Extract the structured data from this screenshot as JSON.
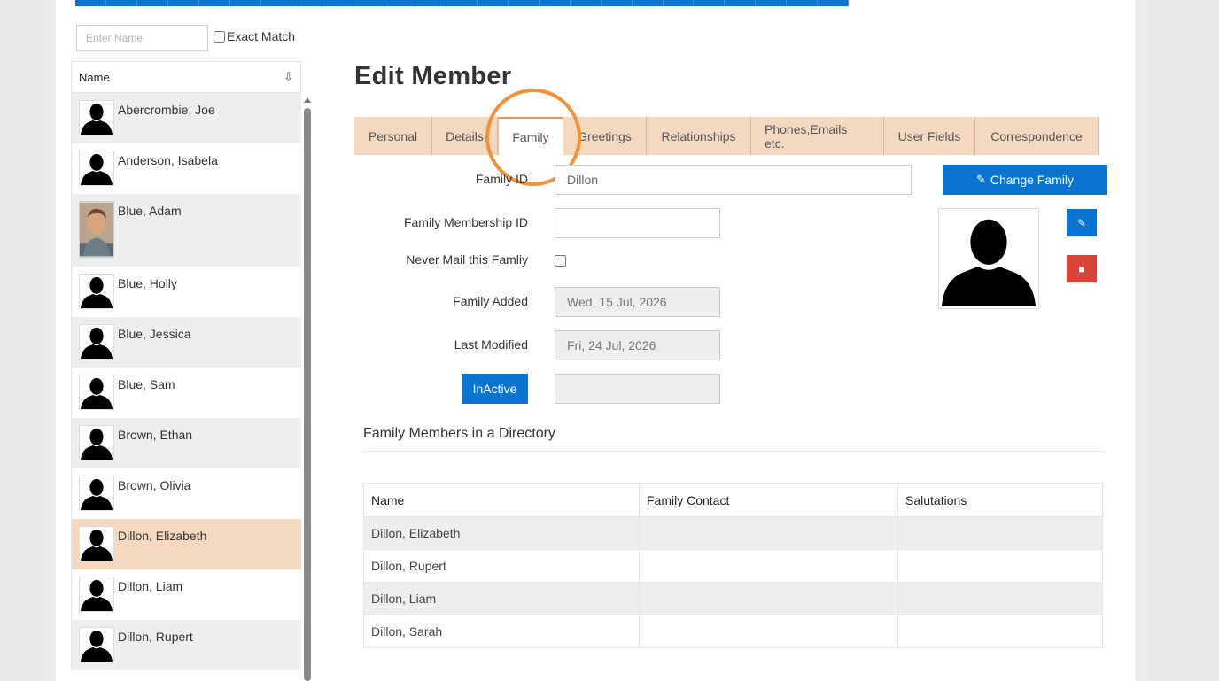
{
  "search": {
    "placeholder": "Enter Name",
    "exact_match_label": "Exact Match"
  },
  "list": {
    "header": "Name",
    "members": [
      {
        "name": "Abercrombie, Joe",
        "style": "alt"
      },
      {
        "name": "Anderson, Isabela",
        "style": ""
      },
      {
        "name": "Blue, Adam",
        "style": "alt"
      },
      {
        "name": "Blue, Holly",
        "style": ""
      },
      {
        "name": "Blue, Jessica",
        "style": "alt"
      },
      {
        "name": "Blue, Sam",
        "style": ""
      },
      {
        "name": "Brown, Ethan",
        "style": "alt"
      },
      {
        "name": "Brown, Olivia",
        "style": ""
      },
      {
        "name": "Dillon, Elizabeth",
        "style": "selected"
      },
      {
        "name": "Dillon, Liam",
        "style": ""
      },
      {
        "name": "Dillon, Rupert",
        "style": "alt"
      }
    ]
  },
  "main": {
    "title": "Edit Member",
    "tabs": [
      "Personal",
      "Details",
      "Family",
      "Greetings",
      "Relationships",
      "Phones,Emails etc.",
      "User Fields",
      "Correspondence"
    ],
    "active_tab": "Family"
  },
  "form": {
    "family_id_label": "Family ID",
    "family_id_value": "Dillon",
    "membership_id_label": "Family Membership ID",
    "membership_id_value": "",
    "never_mail_label": "Never Mail this Famliy",
    "family_added_label": "Family Added",
    "family_added_value": "Wed, 15 Jul, 2026",
    "last_modified_label": "Last Modified",
    "last_modified_value": "Fri, 24 Jul, 2026",
    "inactive_button": "InActive",
    "change_family_button": "Change Family"
  },
  "directory": {
    "title": "Family Members in a Directory",
    "columns": [
      "Name",
      "Family Contact",
      "Salutations"
    ],
    "rows": [
      [
        "Dillon, Elizabeth",
        "",
        ""
      ],
      [
        "Dillon, Rupert",
        "",
        ""
      ],
      [
        "Dillon, Liam",
        "",
        ""
      ],
      [
        "Dillon, Sarah",
        "",
        ""
      ]
    ]
  },
  "colors": {
    "primary": "#0b73d0",
    "tab_bg": "#f4d8bf",
    "selected_row": "#f4d8bf",
    "danger": "#d9443a",
    "highlight": "#f0923b"
  },
  "icons": {
    "edit": "edit-icon",
    "delete": "trash-icon",
    "pencil": "pencil-icon",
    "sort": "sort-alpha-icon"
  }
}
